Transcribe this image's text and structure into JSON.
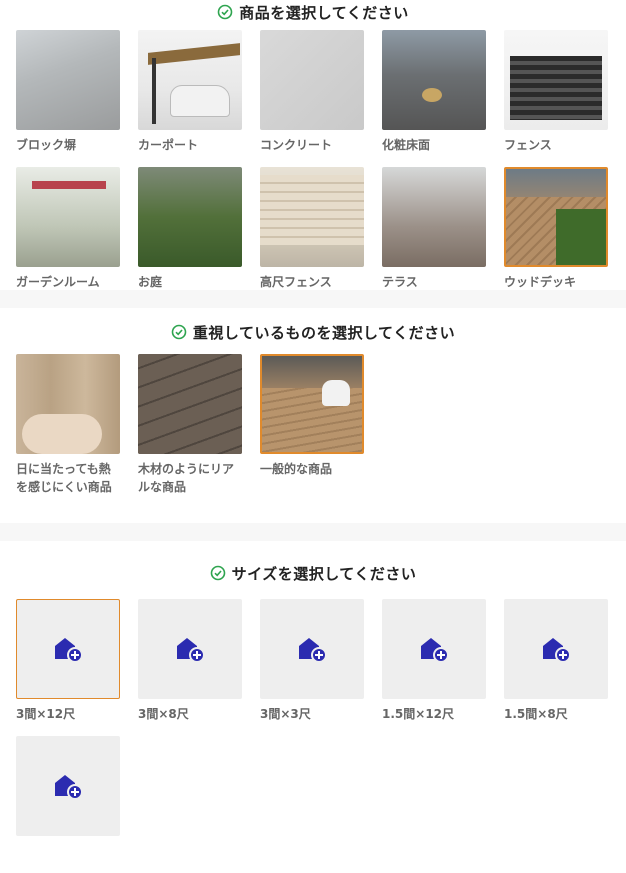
{
  "product_section": {
    "heading": "商品を選択してください",
    "items": [
      {
        "label": "ブロック塀"
      },
      {
        "label": "カーポート"
      },
      {
        "label": "コンクリート"
      },
      {
        "label": "化粧床面"
      },
      {
        "label": "フェンス"
      },
      {
        "label": "ガーデンルーム"
      },
      {
        "label": "お庭"
      },
      {
        "label": "高尺フェンス"
      },
      {
        "label": "テラス"
      },
      {
        "label": "ウッドデッキ",
        "selected": true
      }
    ]
  },
  "priority_section": {
    "heading": "重視しているものを選択してください",
    "items": [
      {
        "label": "日に当たっても熱を感じにくい商品"
      },
      {
        "label": "木材のようにリアルな商品"
      },
      {
        "label": "一般的な商品",
        "selected": true
      }
    ]
  },
  "size_section": {
    "heading": "サイズを選択してください",
    "items": [
      {
        "label": "3間×12尺",
        "selected": true
      },
      {
        "label": "3間×8尺"
      },
      {
        "label": "3間×3尺"
      },
      {
        "label": "1.5間×12尺"
      },
      {
        "label": "1.5間×8尺"
      },
      {
        "label": ""
      }
    ]
  },
  "colors": {
    "accent_check": "#2ea44f",
    "selected_border": "#e08a2c",
    "size_icon": "#2b2bb0"
  },
  "icons": {
    "check": "check-circle-icon",
    "size": "house-plus-icon"
  }
}
